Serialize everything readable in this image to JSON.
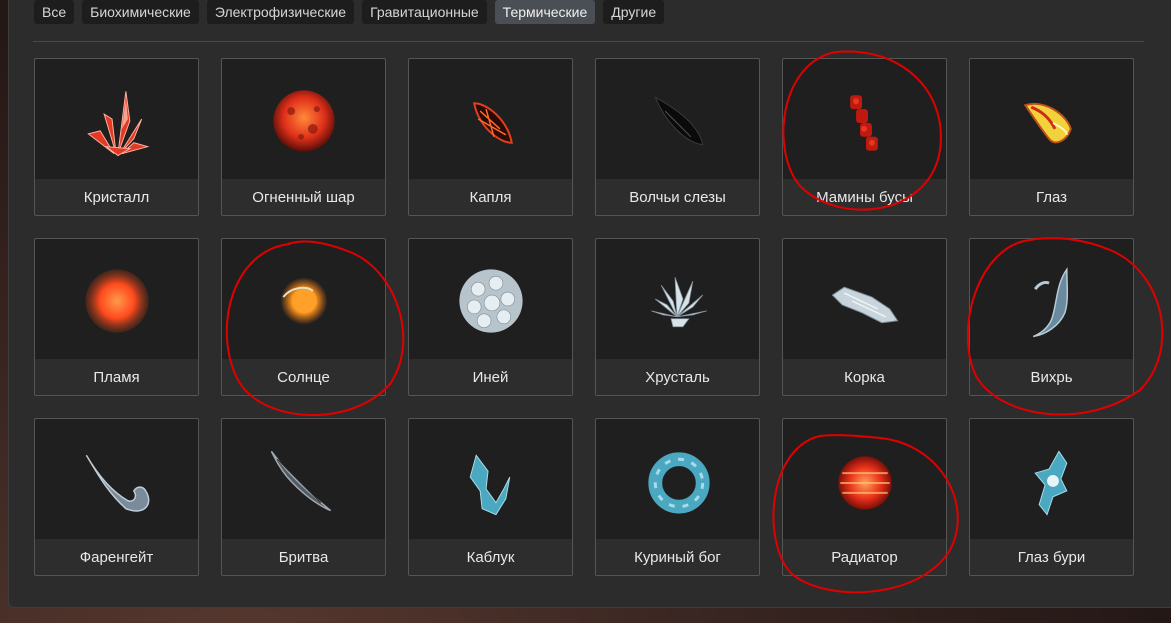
{
  "tabs": [
    {
      "label": "Все",
      "active": false
    },
    {
      "label": "Биохимические",
      "active": false
    },
    {
      "label": "Электрофизические",
      "active": false
    },
    {
      "label": "Гравитационные",
      "active": false
    },
    {
      "label": "Термические",
      "active": true
    },
    {
      "label": "Другие",
      "active": false
    }
  ],
  "items": [
    {
      "label": "Кристалл",
      "icon": "red-crystal-icon"
    },
    {
      "label": "Огненный шар",
      "icon": "fireball-icon"
    },
    {
      "label": "Капля",
      "icon": "lava-drop-icon"
    },
    {
      "label": "Волчьи слезы",
      "icon": "black-shard-icon"
    },
    {
      "label": "Мамины бусы",
      "icon": "red-beads-icon"
    },
    {
      "label": "Глаз",
      "icon": "golden-gem-icon"
    },
    {
      "label": "Пламя",
      "icon": "flame-orb-icon"
    },
    {
      "label": "Солнце",
      "icon": "sun-orb-icon"
    },
    {
      "label": "Иней",
      "icon": "frost-ball-icon"
    },
    {
      "label": "Хрусталь",
      "icon": "crystal-cluster-icon"
    },
    {
      "label": "Корка",
      "icon": "ice-crust-icon"
    },
    {
      "label": "Вихрь",
      "icon": "whirl-horn-icon"
    },
    {
      "label": "Фаренгейт",
      "icon": "hook-icon"
    },
    {
      "label": "Бритва",
      "icon": "razor-icon"
    },
    {
      "label": "Каблук",
      "icon": "ice-heel-icon"
    },
    {
      "label": "Куриный бог",
      "icon": "ice-ring-icon"
    },
    {
      "label": "Радиатор",
      "icon": "radiator-orb-icon"
    },
    {
      "label": "Глаз бури",
      "icon": "storm-eye-icon"
    }
  ],
  "colors": {
    "panel": "#2c2c2c",
    "card": "#1f1f1f",
    "active_tab": "#4a4f55",
    "annotation": "#e00000"
  }
}
